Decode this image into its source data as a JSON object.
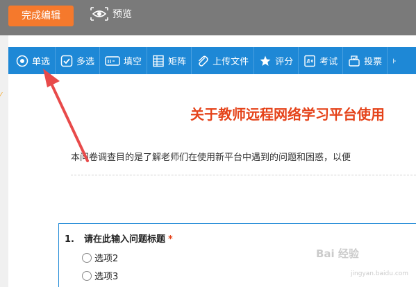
{
  "header": {
    "finish_label": "完成编辑",
    "preview_label": "预览"
  },
  "toolbar": {
    "items": [
      {
        "label": "单选",
        "icon": "radio-icon"
      },
      {
        "label": "多选",
        "icon": "checkbox-icon"
      },
      {
        "label": "填空",
        "icon": "textbox-icon"
      },
      {
        "label": "矩阵",
        "icon": "matrix-icon"
      },
      {
        "label": "上传文件",
        "icon": "paperclip-icon"
      },
      {
        "label": "评分",
        "icon": "star-icon"
      },
      {
        "label": "考试",
        "icon": "exam-icon"
      },
      {
        "label": "投票",
        "icon": "vote-icon"
      }
    ]
  },
  "survey": {
    "title": "关于教师远程网络学习平台使用",
    "description": "本问卷调查目的是了解老师们在使用新平台中遇到的问题和困惑，以便",
    "question": {
      "number": "1.",
      "title": "请在此输入问题标题",
      "required_mark": "*",
      "options": [
        "选项2",
        "选项3"
      ]
    }
  },
  "watermark": {
    "text": "Bai 经验",
    "sub": "jingyan.baidu.com"
  },
  "colors": {
    "accent_orange": "#f5792c",
    "toolbar_blue": "#1e88d6",
    "title_red": "#e5431a",
    "topbar_gray": "#7a7a7a"
  }
}
